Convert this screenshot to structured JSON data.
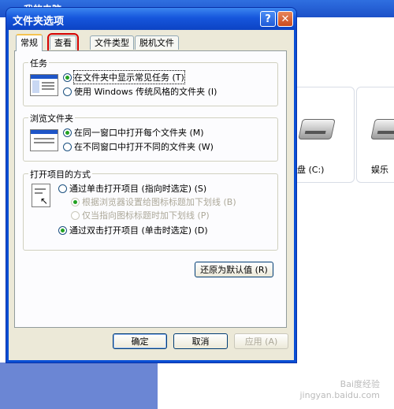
{
  "background_window": {
    "title": "我的电脑",
    "drives": [
      {
        "label": "盘 (C:)"
      },
      {
        "label": "娱乐"
      }
    ],
    "watermark_line1": "Bai度经验",
    "watermark_line2": "jingyan.baidu.com"
  },
  "dialog": {
    "title": "文件夹选项",
    "help_glyph": "?",
    "close_glyph": "✕",
    "tabs": [
      {
        "label": "常规",
        "active": true
      },
      {
        "label": "查看",
        "highlighted": true
      },
      {
        "label": "文件类型"
      },
      {
        "label": "脱机文件"
      }
    ],
    "tasks": {
      "title": "任务",
      "options": [
        {
          "label": "在文件夹中显示常见任务 (T)",
          "selected": true
        },
        {
          "label": "使用 Windows 传统风格的文件夹 (I)",
          "selected": false
        }
      ]
    },
    "browse": {
      "title": "浏览文件夹",
      "options": [
        {
          "label": "在同一窗口中打开每个文件夹 (M)",
          "selected": true
        },
        {
          "label": "在不同窗口中打开不同的文件夹 (W)",
          "selected": false
        }
      ]
    },
    "open_items": {
      "title": "打开项目的方式",
      "options": [
        {
          "label": "通过单击打开项目 (指向时选定) (S)",
          "selected": false
        },
        {
          "label": "根据浏览器设置给图标标题加下划线 (B)",
          "selected": true,
          "disabled": true
        },
        {
          "label": "仅当指向图标标题时加下划线 (P)",
          "selected": false,
          "disabled": true
        },
        {
          "label": "通过双击打开项目 (单击时选定) (D)",
          "selected": true
        }
      ]
    },
    "restore_defaults": "还原为默认值 (R)",
    "ok": "确定",
    "cancel": "取消",
    "apply": "应用 (A)"
  },
  "colors": {
    "titlebar": "#1656dc",
    "dialog_bg": "#ece9d8",
    "highlight_box": "#d40000",
    "radio_dot": "#21a121"
  }
}
